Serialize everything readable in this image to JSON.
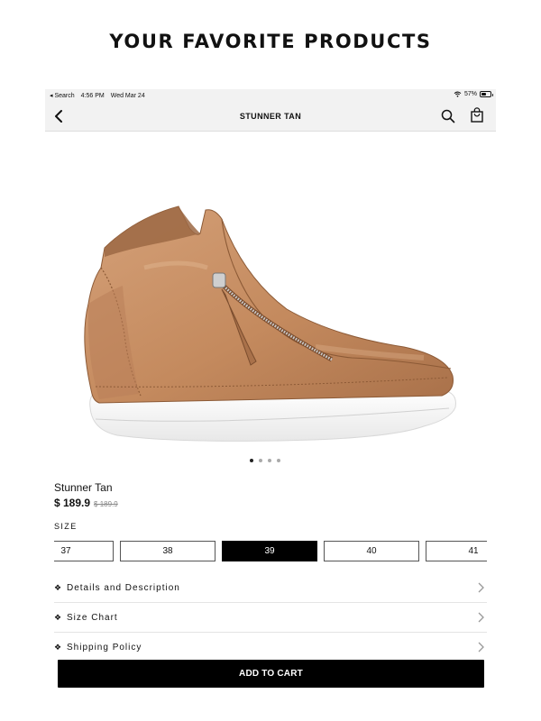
{
  "headline": "YOUR FAVORITE PRODUCTS",
  "status_bar": {
    "back_app": "◂ Search",
    "time": "4:56 PM",
    "date": "Wed Mar 24",
    "battery": "57%",
    "battery_level": 0.57
  },
  "nav": {
    "title": "STUNNER TAN",
    "icons": [
      "back-chevron-icon",
      "search-icon",
      "shopping-bag-icon"
    ]
  },
  "gallery": {
    "image": "tan leather high-top sneaker with side zipper",
    "dot_count": 4,
    "active_index": 0
  },
  "product": {
    "name": "Stunner Tan",
    "price": "$ 189.9",
    "old_price": "$ 189.9"
  },
  "size": {
    "label": "SIZE",
    "options": [
      "37",
      "38",
      "39",
      "40",
      "41"
    ],
    "selected": "39"
  },
  "accordion": [
    {
      "bullet": "❖",
      "label": "Details and Description"
    },
    {
      "bullet": "❖",
      "label": "Size Chart"
    },
    {
      "bullet": "❖",
      "label": "Shipping Policy"
    }
  ],
  "cta": {
    "label": "ADD TO CART"
  },
  "colors": {
    "accent": "#000000",
    "bar_bg": "#f2f2f2",
    "leather": "#c48a5e"
  }
}
